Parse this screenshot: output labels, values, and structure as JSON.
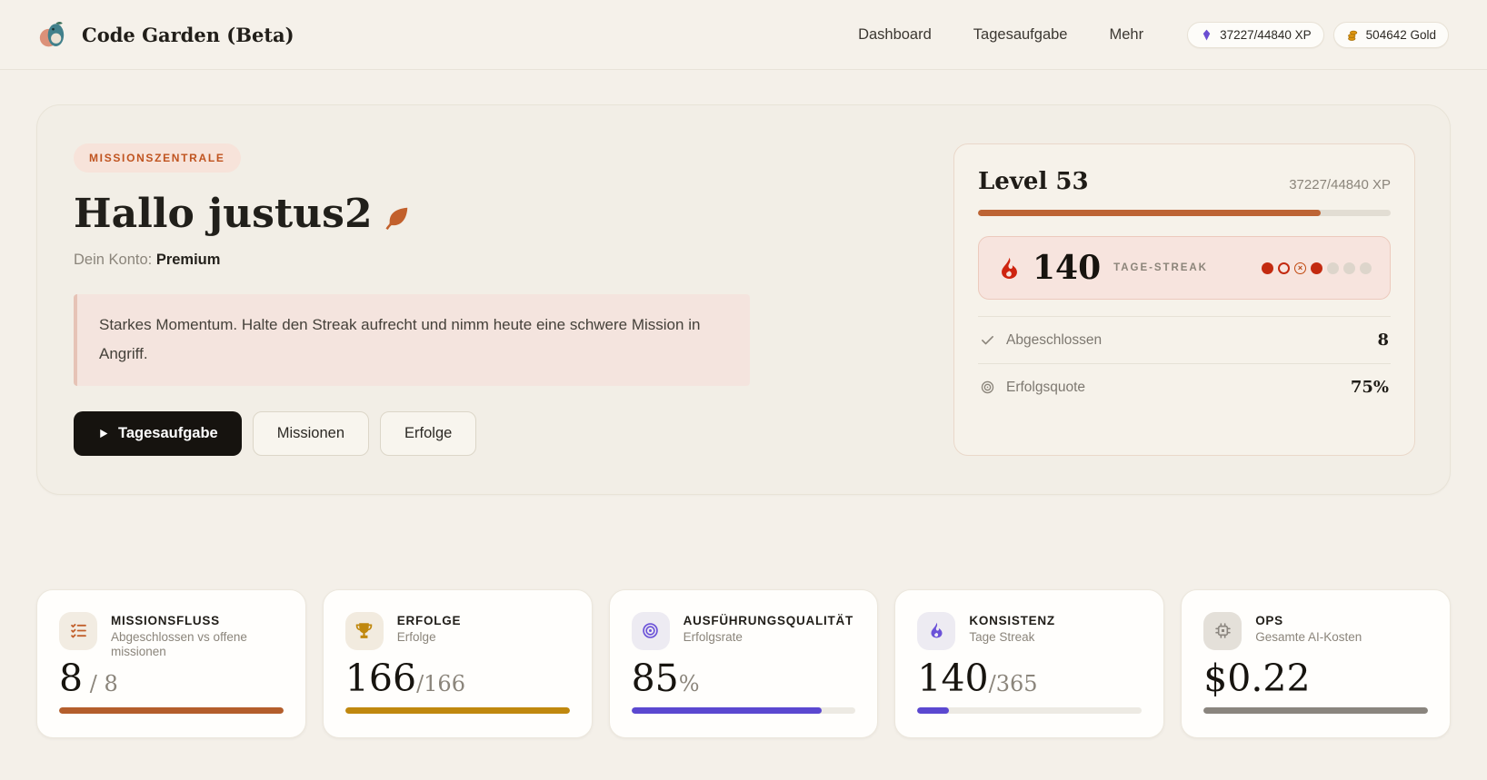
{
  "app": {
    "title": "Code Garden (Beta)"
  },
  "nav": {
    "items": [
      "Dashboard",
      "Tagesaufgabe",
      "Mehr"
    ]
  },
  "badges": {
    "xp": "37227/44840 XP",
    "gold": "504642 Gold"
  },
  "colors": {
    "accent_orange": "#bd6434",
    "accent_red": "#c32a10",
    "accent_purple": "#5b48d0",
    "accent_gold": "#c0880e",
    "accent_gray": "#8a857e"
  },
  "hero": {
    "eyebrow": "MISSIONSZENTRALE",
    "greeting": "Hallo justus2",
    "account_label": "Dein Konto:",
    "account_value": "Premium",
    "message": "Starkes Momentum. Halte den Streak aufrecht und nimm heute eine schwere Mission in Angriff.",
    "buttons": {
      "primary": "Tagesaufgabe",
      "secondary": "Missionen",
      "tertiary": "Erfolge"
    }
  },
  "level_card": {
    "title": "Level 53",
    "xp": "37227/44840 XP",
    "progress_pct": 83,
    "progress_color": "#bd6434",
    "streak": {
      "value": "140",
      "label": "TAGE-STREAK",
      "dots": [
        "filled",
        "outline",
        "missed",
        "filled",
        "empty",
        "empty",
        "empty"
      ]
    },
    "rows": [
      {
        "label": "Abgeschlossen",
        "value": "8"
      },
      {
        "label": "Erfolgsquote",
        "value": "75%"
      }
    ]
  },
  "stats": {
    "cards": [
      {
        "title": "MISSIONSFLUSS",
        "subtitle": "Abgeschlossen vs offene missionen",
        "value": "8",
        "value_suffix": " / 8",
        "bar_pct": 100,
        "bar_color": "#b45e2c",
        "icon": "checklist-icon"
      },
      {
        "title": "ERFOLGE",
        "subtitle": "Erfolge",
        "value": "166",
        "value_suffix": "/166",
        "bar_pct": 100,
        "bar_color": "#c0880e",
        "icon": "trophy-icon"
      },
      {
        "title": "AUSFÜHRUNGSQUALITÄT",
        "subtitle": "Erfolgsrate",
        "value": "85",
        "value_suffix": "%",
        "bar_pct": 85,
        "bar_color": "#5b48d0",
        "icon": "bullseye-icon"
      },
      {
        "title": "KONSISTENZ",
        "subtitle": "Tage Streak",
        "value": "140",
        "value_suffix": "/365",
        "bar_pct": 14,
        "bar_color": "#5b48d0",
        "icon": "streak-flame-icon"
      },
      {
        "title": "OPS",
        "subtitle": "Gesamte AI-Kosten",
        "value": "$0.22",
        "value_suffix": "",
        "bar_pct": 100,
        "bar_color": "#8a857e",
        "icon": "chip-icon"
      }
    ]
  }
}
